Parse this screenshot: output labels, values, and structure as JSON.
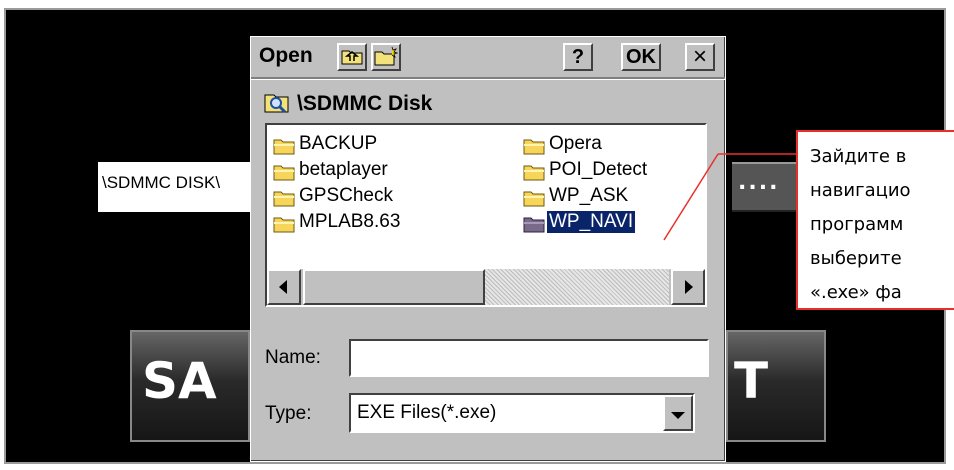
{
  "background": {
    "path_field": "\\SDMMC DISK\\",
    "browse_label": "....",
    "left_button_label": "SA",
    "right_button_label": "T"
  },
  "dialog": {
    "title": "Open",
    "help_label": "?",
    "ok_label": "OK",
    "close_label": "×",
    "current_folder": "\\SDMMC Disk",
    "files": [
      {
        "name": "BACKUP",
        "selected": false
      },
      {
        "name": "betaplayer",
        "selected": false
      },
      {
        "name": "GPSCheck",
        "selected": false
      },
      {
        "name": "MPLAB8.63",
        "selected": false
      },
      {
        "name": "Opera",
        "selected": false
      },
      {
        "name": "POI_Detect",
        "selected": false
      },
      {
        "name": "WP_ASK",
        "selected": false
      },
      {
        "name": "WP_NAVI",
        "selected": true
      }
    ],
    "name_label": "Name:",
    "name_value": "",
    "type_label": "Type:",
    "type_value": "EXE Files(*.exe)"
  },
  "callout": {
    "lines": [
      "Зайдите в",
      "навигацио",
      "программ",
      "выберите",
      "«.exe» фа"
    ]
  },
  "colors": {
    "accent_red": "#e8302a",
    "selection": "#0a246a",
    "dialog_face": "#c0c0c0"
  },
  "icons": {
    "up_folder": "up-folder-icon",
    "new_folder": "new-folder-icon",
    "folder": "folder-icon",
    "drive": "drive-search-icon"
  }
}
